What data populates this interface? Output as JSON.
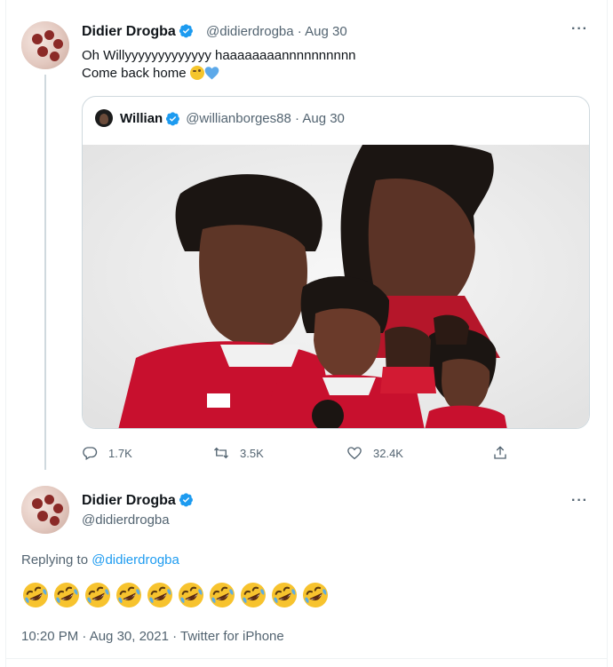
{
  "tweet": {
    "author_name": "Didier Drogba",
    "author_handle": "@didierdrogba",
    "dot": "·",
    "date": "Aug 30",
    "text_line1": "Oh Willyyyyyyyyyyyyy haaaaaaaannnnnnnnnn",
    "text_line2": "Come back home",
    "emojis": [
      "winking-face",
      "blue-heart"
    ],
    "more_icon": "more-dots-icon"
  },
  "quoted_tweet": {
    "author_name": "Willian",
    "author_handle": "@willianborges88",
    "dot": "·",
    "date": "Aug 30",
    "image_subject": "Willian in Arsenal red and white kit, multiple portraits collage"
  },
  "actions": {
    "reply_count": "1.7K",
    "retweet_count": "3.5K",
    "like_count": "32.4K",
    "icons": [
      "reply-icon",
      "retweet-icon",
      "like-icon",
      "share-icon"
    ]
  },
  "reply": {
    "author_name": "Didier Drogba",
    "author_handle": "@didierdrogba",
    "replying_prefix": "Replying to ",
    "replying_to": "@didierdrogba",
    "emoji_name": "rolling-on-the-floor-laughing",
    "emoji_count": 10,
    "timestamp": "10:20 PM · Aug 30, 2021 · Twitter for iPhone"
  },
  "colors": {
    "brand_blue": "#1d9bf0",
    "secondary_text": "#536471",
    "border": "#cfd9de",
    "arsenal_red": "#c8102e"
  }
}
